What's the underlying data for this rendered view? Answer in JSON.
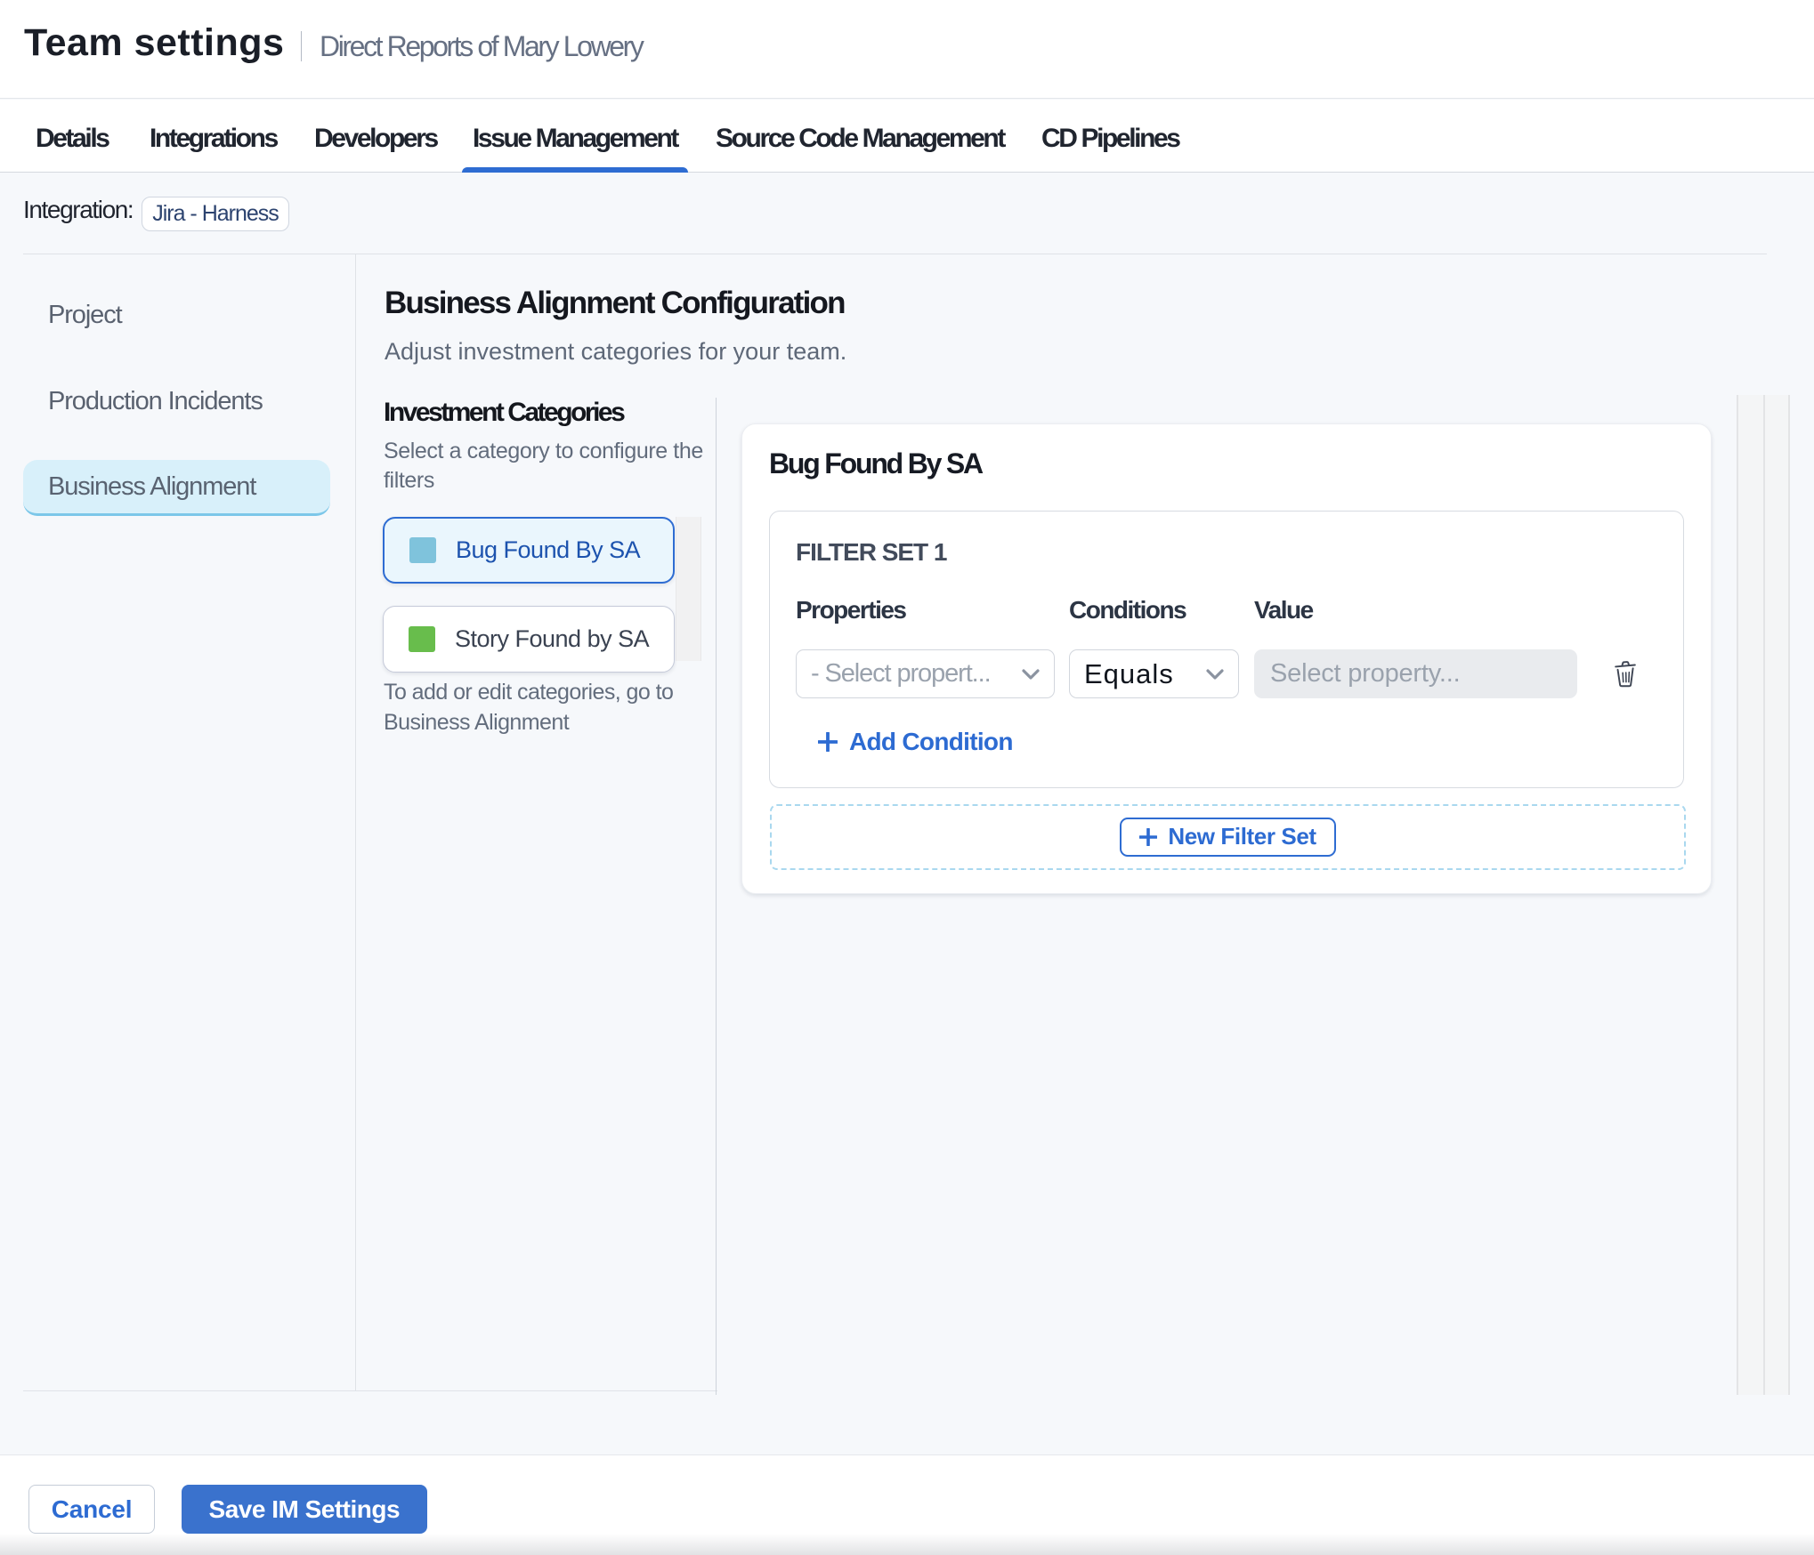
{
  "page": {
    "title": "Team settings",
    "subtitle": "Direct Reports of Mary Lowery"
  },
  "tabs": {
    "items": [
      {
        "label": "Details"
      },
      {
        "label": "Integrations"
      },
      {
        "label": "Developers"
      },
      {
        "label": "Issue Management"
      },
      {
        "label": "Source Code Management"
      },
      {
        "label": "CD Pipelines"
      }
    ],
    "active_label": "Issue Management"
  },
  "integration": {
    "label": "Integration:",
    "value": "Jira - Harness"
  },
  "sidebar": {
    "items": [
      {
        "label": "Project"
      },
      {
        "label": "Production Incidents"
      },
      {
        "label": "Business Alignment"
      }
    ],
    "active_label": "Business Alignment"
  },
  "main": {
    "title": "Business Alignment Configuration",
    "subtitle": "Adjust investment categories for your team."
  },
  "categories": {
    "title": "Investment Categories",
    "hint": "Select a category to configure the filters",
    "items": [
      {
        "label": "Bug Found By SA",
        "swatch": "#7fc3dc",
        "selected": true
      },
      {
        "label": "Story Found by SA",
        "swatch": "#68bd4c",
        "selected": false
      }
    ],
    "footnote": "To add or edit categories, go to Business Alignment"
  },
  "filter_panel": {
    "title": "Bug Found By SA",
    "set_label": "FILTER SET 1",
    "columns": {
      "properties": "Properties",
      "conditions": "Conditions",
      "value": "Value"
    },
    "property_select": {
      "placeholder": "- Select propert..."
    },
    "condition_select": {
      "value": "Equals"
    },
    "value_input": {
      "placeholder": "Select property..."
    },
    "add_condition": "Add Condition",
    "new_filter_set": "New Filter Set"
  },
  "footer": {
    "cancel": "Cancel",
    "save": "Save IM Settings"
  },
  "colors": {
    "accent": "#2e6cd2",
    "tab_underline": "#2e6cd2",
    "active_sidebar_bg": "#d8f0fa",
    "category_blue_swatch": "#7fc3dc",
    "category_green_swatch": "#68bd4c",
    "save_button_bg": "#3a72cd"
  }
}
